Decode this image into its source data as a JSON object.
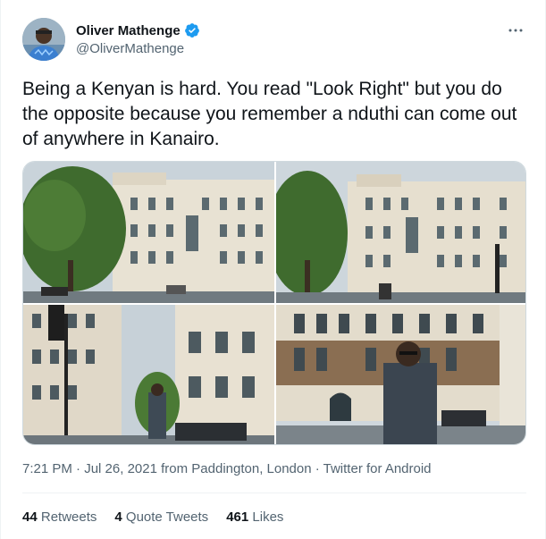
{
  "author": {
    "display_name": "Oliver Mathenge",
    "handle": "@OliverMathenge",
    "verified": true
  },
  "tweet": {
    "text": "Being a Kenyan is hard. You read \"Look Right\" but you do the opposite because you remember a nduthi can come out of anywhere in Kanairo."
  },
  "media": {
    "photo_count": 4
  },
  "meta": {
    "time": "7:21 PM",
    "separator1": " · ",
    "date": "Jul 26, 2021",
    "location": " from Paddington, London",
    "separator2": " · ",
    "source": "Twitter for Android"
  },
  "stats": {
    "retweets_count": "44",
    "retweets_label": "Retweets",
    "quotes_count": "4",
    "quotes_label": "Quote Tweets",
    "likes_count": "461",
    "likes_label": "Likes"
  },
  "colors": {
    "verified": "#1d9bf0",
    "secondary_text": "#536471",
    "primary_text": "#0f1419"
  },
  "icons": [
    "verified-badge-icon",
    "more-options-icon"
  ]
}
